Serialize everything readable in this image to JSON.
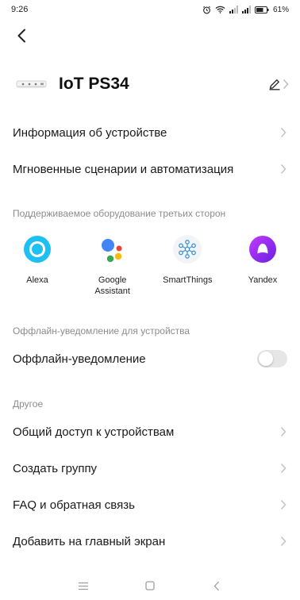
{
  "status_bar": {
    "time": "9:26",
    "battery": "61%"
  },
  "device": {
    "name": "IoT PS34"
  },
  "menu_top": [
    {
      "label": "Информация об устройстве"
    },
    {
      "label": "Мгновенные сценарии и автоматизация"
    }
  ],
  "third_party": {
    "title": "Поддерживаемое оборудование третьих сторон",
    "items": [
      {
        "name": "Alexa",
        "icon": "alexa-icon"
      },
      {
        "name": "Google\nAssistant",
        "icon": "google-assistant-icon"
      },
      {
        "name": "SmartThings",
        "icon": "smartthings-icon"
      },
      {
        "name": "Yandex",
        "icon": "yandex-alice-icon"
      }
    ]
  },
  "offline": {
    "title": "Оффлайн-уведомление для устройства",
    "toggle_label": "Оффлайн-уведомление",
    "enabled": false
  },
  "other": {
    "title": "Другое",
    "items": [
      {
        "label": "Общий доступ к устройствам"
      },
      {
        "label": "Создать группу"
      },
      {
        "label": "FAQ и обратная связь"
      },
      {
        "label": "Добавить на главный экран"
      }
    ]
  },
  "colors": {
    "alexa": "#1ec0f2",
    "yandex": "#8a2be2",
    "google_blue": "#4285f4",
    "google_red": "#ea4335",
    "google_yellow": "#fbbc05",
    "google_green": "#34a853",
    "toggle_off": "#e6e6e6"
  }
}
